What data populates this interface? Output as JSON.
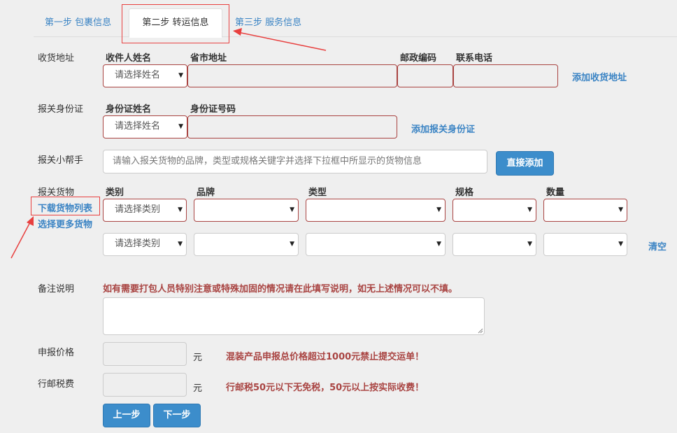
{
  "tabs": [
    {
      "label": "第一步 包裹信息"
    },
    {
      "label": "第二步 转运信息"
    },
    {
      "label": "第三步 服务信息"
    }
  ],
  "address": {
    "label": "收货地址",
    "headers": {
      "name": "收件人姓名",
      "region": "省市地址",
      "postcode": "邮政编码",
      "phone": "联系电话"
    },
    "name_select": "请选择姓名",
    "add_link": "添加收货地址"
  },
  "idcard": {
    "label": "报关身份证",
    "headers": {
      "name": "身份证姓名",
      "number": "身份证号码"
    },
    "name_select": "请选择姓名",
    "add_link": "添加报关身份证"
  },
  "helper": {
    "label": "报关小帮手",
    "placeholder": "请输入报关货物的品牌，类型或规格关键字并选择下拉框中所显示的货物信息",
    "add_button": "直接添加"
  },
  "goods": {
    "label": "报关货物",
    "download_link": "下载货物列表",
    "more_link": "选择更多货物",
    "headers": {
      "category": "类别",
      "brand": "品牌",
      "type": "类型",
      "spec": "规格",
      "qty": "数量"
    },
    "rows": [
      {
        "category": "请选择类别"
      },
      {
        "category": "请选择类别"
      }
    ],
    "clear_link": "清空"
  },
  "remark": {
    "label": "备注说明",
    "hint": "如有需要打包人员特别注意或特殊加固的情况请在此填写说明，如无上述情况可以不填。"
  },
  "declared_price": {
    "label": "申报价格",
    "unit": "元",
    "warning": "混装产品申报总价格超过1000元禁止提交运单！"
  },
  "postal_tax": {
    "label": "行邮税费",
    "unit": "元",
    "warning": "行邮税50元以下无免税，50元以上按实际收费！"
  },
  "buttons": {
    "prev": "上一步",
    "next": "下一步"
  },
  "colors": {
    "link": "#3b84c4",
    "error": "#a94442",
    "primary": "#3c8dcb",
    "highlight": "#e8403f"
  }
}
